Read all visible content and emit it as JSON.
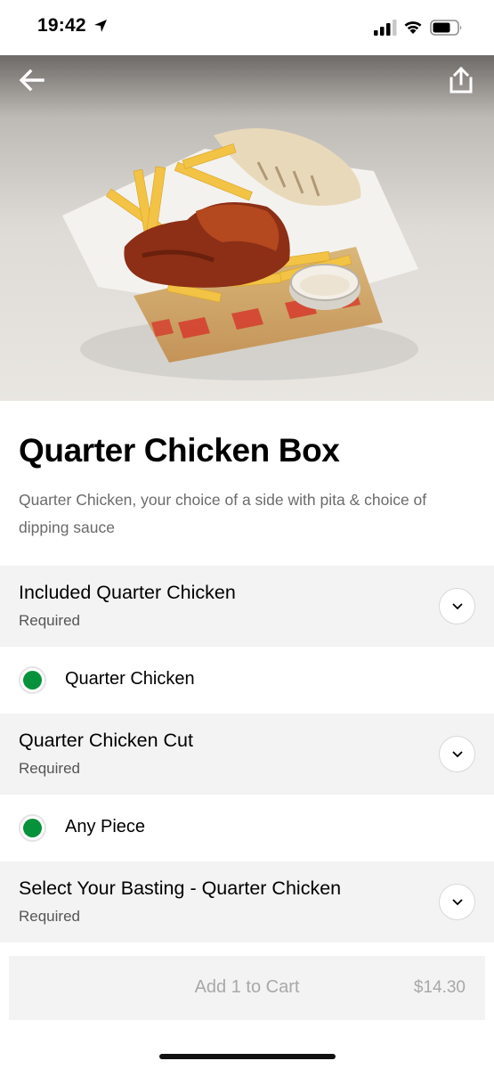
{
  "status_bar": {
    "time": "19:42",
    "icons": [
      "location-arrow-icon",
      "cellular-signal-icon",
      "wifi-icon",
      "battery-icon"
    ]
  },
  "hero": {
    "back_icon": "arrow-left-icon",
    "share_icon": "share-icon"
  },
  "item": {
    "title": "Quarter Chicken Box",
    "description": "Quarter Chicken, your choice of a side with pita & choice of dipping sauce"
  },
  "option_groups": [
    {
      "title": "Included Quarter Chicken",
      "status": "Required",
      "selected": "Quarter Chicken"
    },
    {
      "title": "Quarter Chicken Cut",
      "status": "Required",
      "selected": "Any Piece"
    },
    {
      "title": "Select Your Basting - Quarter Chicken",
      "status": "Required"
    }
  ],
  "cart": {
    "label": "Add 1 to Cart",
    "price": "$14.30"
  },
  "colors": {
    "radio_selected": "#06913b",
    "section_bg": "#f3f3f3",
    "muted_text": "#6b6b6b",
    "disabled_text": "#a8a8a8"
  }
}
